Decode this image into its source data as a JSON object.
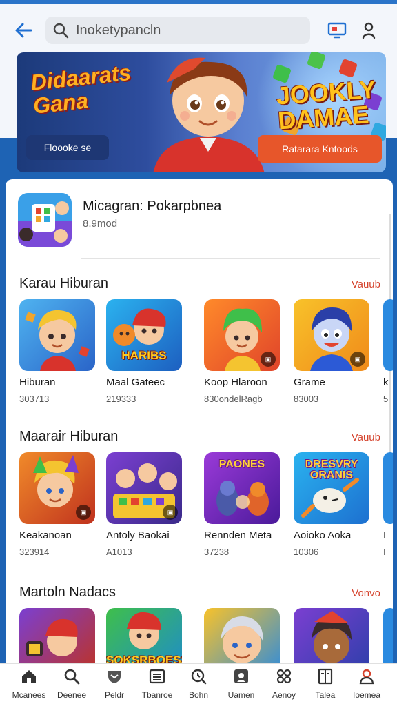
{
  "search": {
    "query": "Inoketypancln"
  },
  "banner": {
    "title": "Didaarats Gana",
    "right_title": "JOOKLY DAMAE",
    "left_button": "Floooke se",
    "right_button": "Ratarara Kntoods"
  },
  "app": {
    "name": "Micagran: Pokarpbnea",
    "size": "8.9mod"
  },
  "sections": [
    {
      "title": "Karau Hiburan",
      "more": "Vauub",
      "items": [
        {
          "name": "Hiburan",
          "meta": "303713"
        },
        {
          "name": "Maal Gateec",
          "meta": "219333",
          "wordmark": "HARIBS"
        },
        {
          "name": "Koop Hlaroon",
          "meta": "830ondelRagb"
        },
        {
          "name": "Grame",
          "meta": "83003"
        },
        {
          "name": "k",
          "meta": "5"
        }
      ]
    },
    {
      "title": "Maarair Hiburan",
      "more": "Vauub",
      "items": [
        {
          "name": "Keakanoan",
          "meta": "323914"
        },
        {
          "name": "Antoly Baokai",
          "meta": "A1013"
        },
        {
          "name": "Rennden Meta",
          "meta": "37238",
          "wordmark": "PAONES"
        },
        {
          "name": "Aoioko Aoka",
          "meta": "10306",
          "wordmark": "DRESVRY ORANIS"
        },
        {
          "name": "I",
          "meta": "I"
        }
      ]
    },
    {
      "title": "Martoln Nadacs",
      "more": "Vonvo",
      "items": [
        {
          "name": "",
          "meta": ""
        },
        {
          "name": "",
          "meta": "",
          "wordmark": "SOKSRBOESS"
        },
        {
          "name": "",
          "meta": ""
        },
        {
          "name": "",
          "meta": ""
        }
      ]
    }
  ],
  "nav": [
    {
      "label": "Mcanees",
      "icon": "home-icon"
    },
    {
      "label": "Deenee",
      "icon": "search-icon"
    },
    {
      "label": "Peldr",
      "icon": "shield-icon"
    },
    {
      "label": "Tbanroe",
      "icon": "list-icon"
    },
    {
      "label": "Bohn",
      "icon": "clock-icon"
    },
    {
      "label": "Uamen",
      "icon": "game-icon"
    },
    {
      "label": "Aenoy",
      "icon": "apps-icon"
    },
    {
      "label": "Talea",
      "icon": "book-icon"
    },
    {
      "label": "Ioemea",
      "icon": "profile-icon"
    }
  ],
  "colors": {
    "accent": "#1f6fd1",
    "more_link": "#d5432d",
    "cta": "#e7562a"
  }
}
